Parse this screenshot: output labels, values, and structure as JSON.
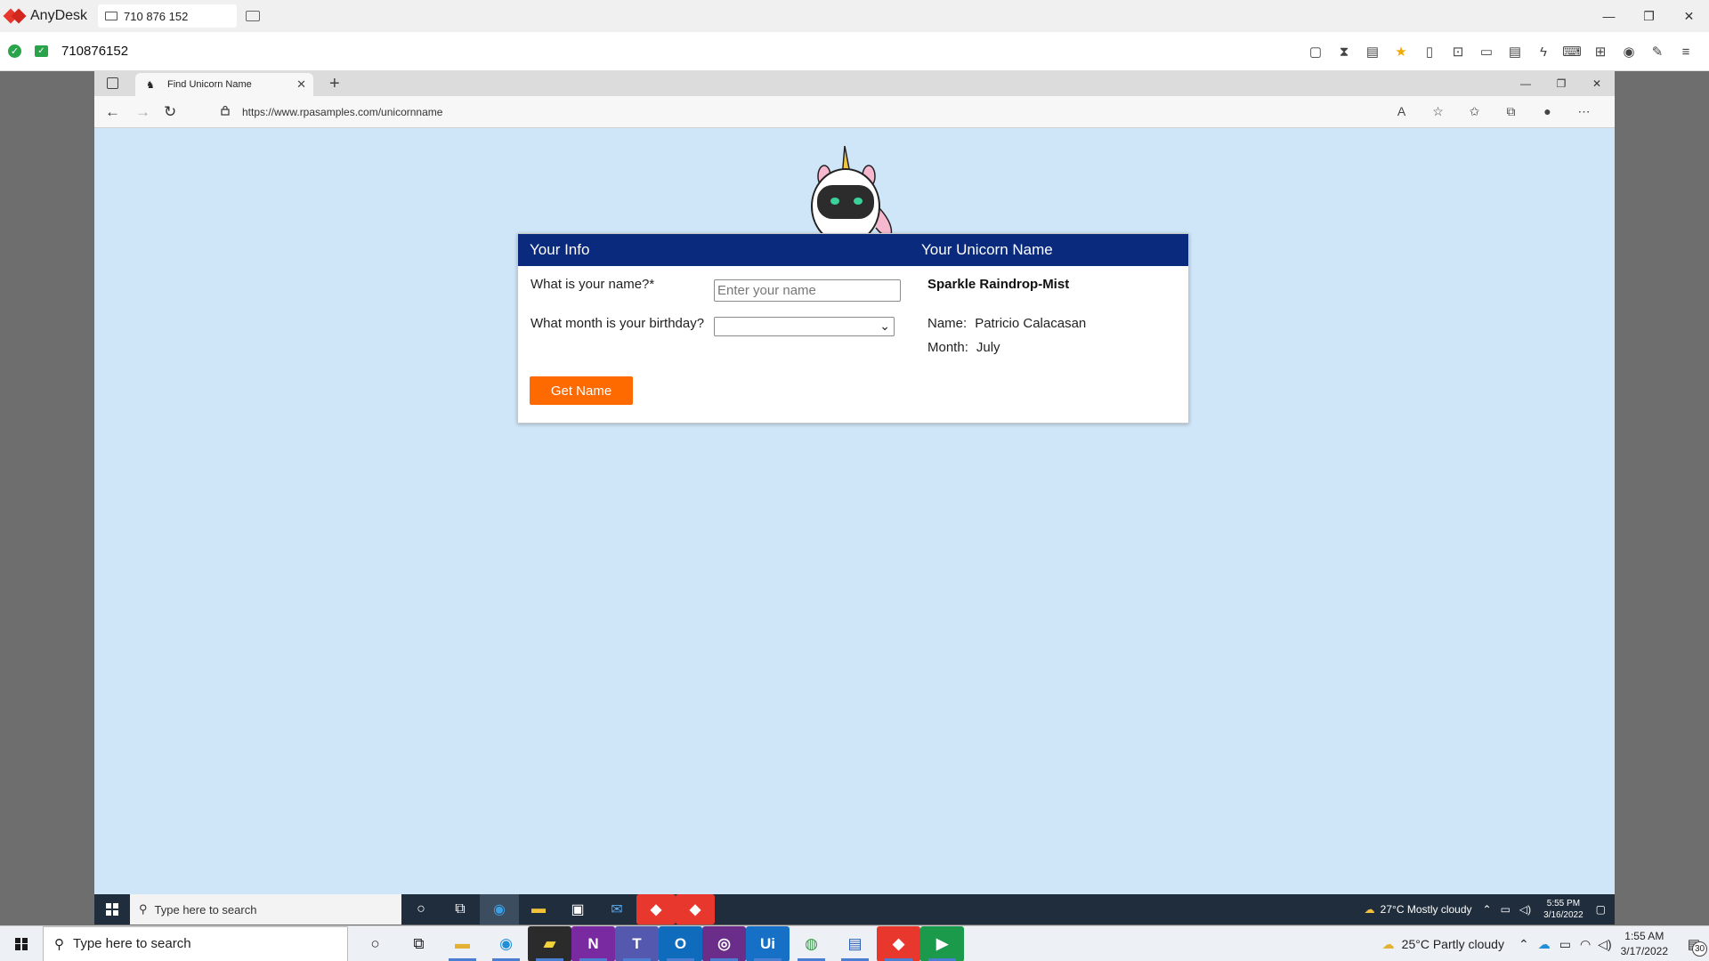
{
  "anydesk": {
    "app_name": "AnyDesk",
    "tab_label": "710 876 152",
    "address_id": "710876152",
    "window_controls": [
      "—",
      "❐",
      "✕"
    ]
  },
  "browser": {
    "tab_title": "Find Unicorn Name",
    "url": "https://www.rpasamples.com/unicornname",
    "new_tab": "+"
  },
  "page": {
    "header_left": "Your Info",
    "header_right": "Your Unicorn Name",
    "name_label": "What is your name?*",
    "name_placeholder": "Enter your name",
    "name_value": "",
    "month_label": "What month is your birthday?",
    "month_value": "",
    "button_label": "Get Name",
    "unicorn_name": "Sparkle Raindrop-Mist",
    "result_name_key": "Name:",
    "result_name_value": "Patricio Calacasan",
    "result_month_key": "Month:",
    "result_month_value": "July",
    "colors": {
      "header": "#0a2a7e",
      "button": "#ff6a00",
      "page_bg": "#cfe6f8"
    }
  },
  "inner_taskbar": {
    "search_placeholder": "Type here to search",
    "weather": "27°C  Mostly cloudy",
    "time": "5:55 PM",
    "date": "3/16/2022"
  },
  "taskbar": {
    "search_placeholder": "Type here to search",
    "weather": "25°C  Partly cloudy",
    "time": "1:55 AM",
    "date": "3/17/2022",
    "notification_count": "30"
  }
}
